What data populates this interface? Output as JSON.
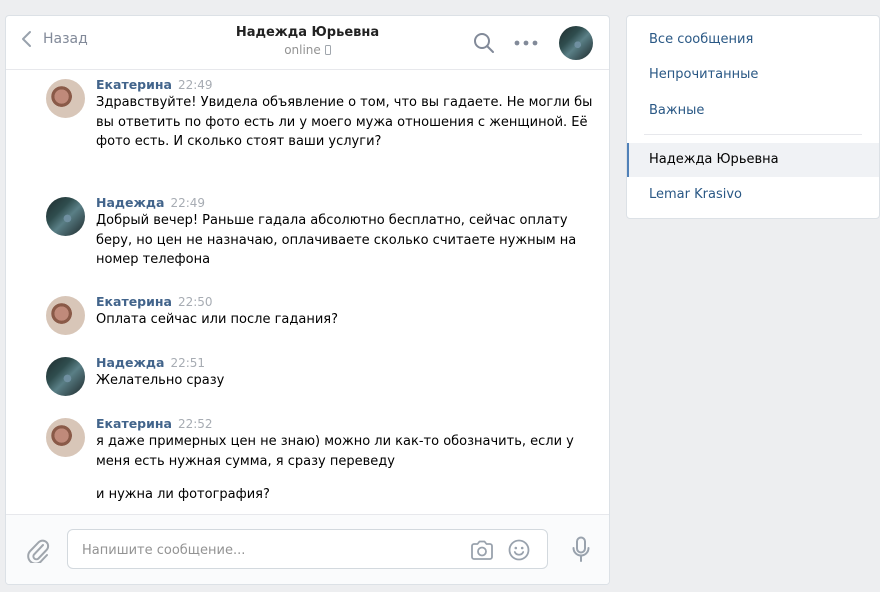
{
  "header": {
    "back_label": "Назад",
    "peer_name": "Надежда Юрьевна",
    "peer_status": "online"
  },
  "icons": {
    "back": "chevron-left-icon",
    "search": "search-icon",
    "more": "more-icon",
    "mobile": "mobile-phone-icon",
    "attach": "paperclip-icon",
    "camera": "camera-icon",
    "emoji": "smile-icon",
    "mic": "microphone-icon"
  },
  "colors": {
    "author": "#42648b",
    "link": "#2a5885",
    "active_marker": "#5181b8",
    "background": "#edeef0"
  },
  "messages": [
    {
      "author": "Екатерина",
      "time": "22:49",
      "lines": [
        "Здравствуйте! Увидела объявление о том, что вы гадаете. Не могли бы вы ответить по фото есть ли у моего мужа отношения с женщиной. Её фото есть. И сколько стоят ваши услуги?"
      ]
    },
    {
      "author": "Надежда",
      "time": "22:49",
      "lines": [
        "Добрый вечер! Раньше гадала абсолютно бесплатно, сейчас оплату беру, но цен не назначаю, оплачиваете сколько считаете нужным на номер телефона"
      ]
    },
    {
      "author": "Екатерина",
      "time": "22:50",
      "lines": [
        "Оплата сейчас или после гадания?"
      ]
    },
    {
      "author": "Надежда",
      "time": "22:51",
      "lines": [
        "Желательно сразу"
      ]
    },
    {
      "author": "Екатерина",
      "time": "22:52",
      "lines": [
        "я даже примерных цен не знаю) можно ли как-то обозначить, если у меня есть нужная сумма, я сразу переведу",
        "и нужна ли фотография?"
      ]
    }
  ],
  "composer": {
    "placeholder": "Напишите сообщение..."
  },
  "sidebar": {
    "items": [
      {
        "label": "Все сообщения"
      },
      {
        "label": "Непрочитанные"
      },
      {
        "label": "Важные"
      },
      {
        "label": "Надежда Юрьевна",
        "active": true
      },
      {
        "label": "Lemar Krasivo"
      }
    ]
  }
}
